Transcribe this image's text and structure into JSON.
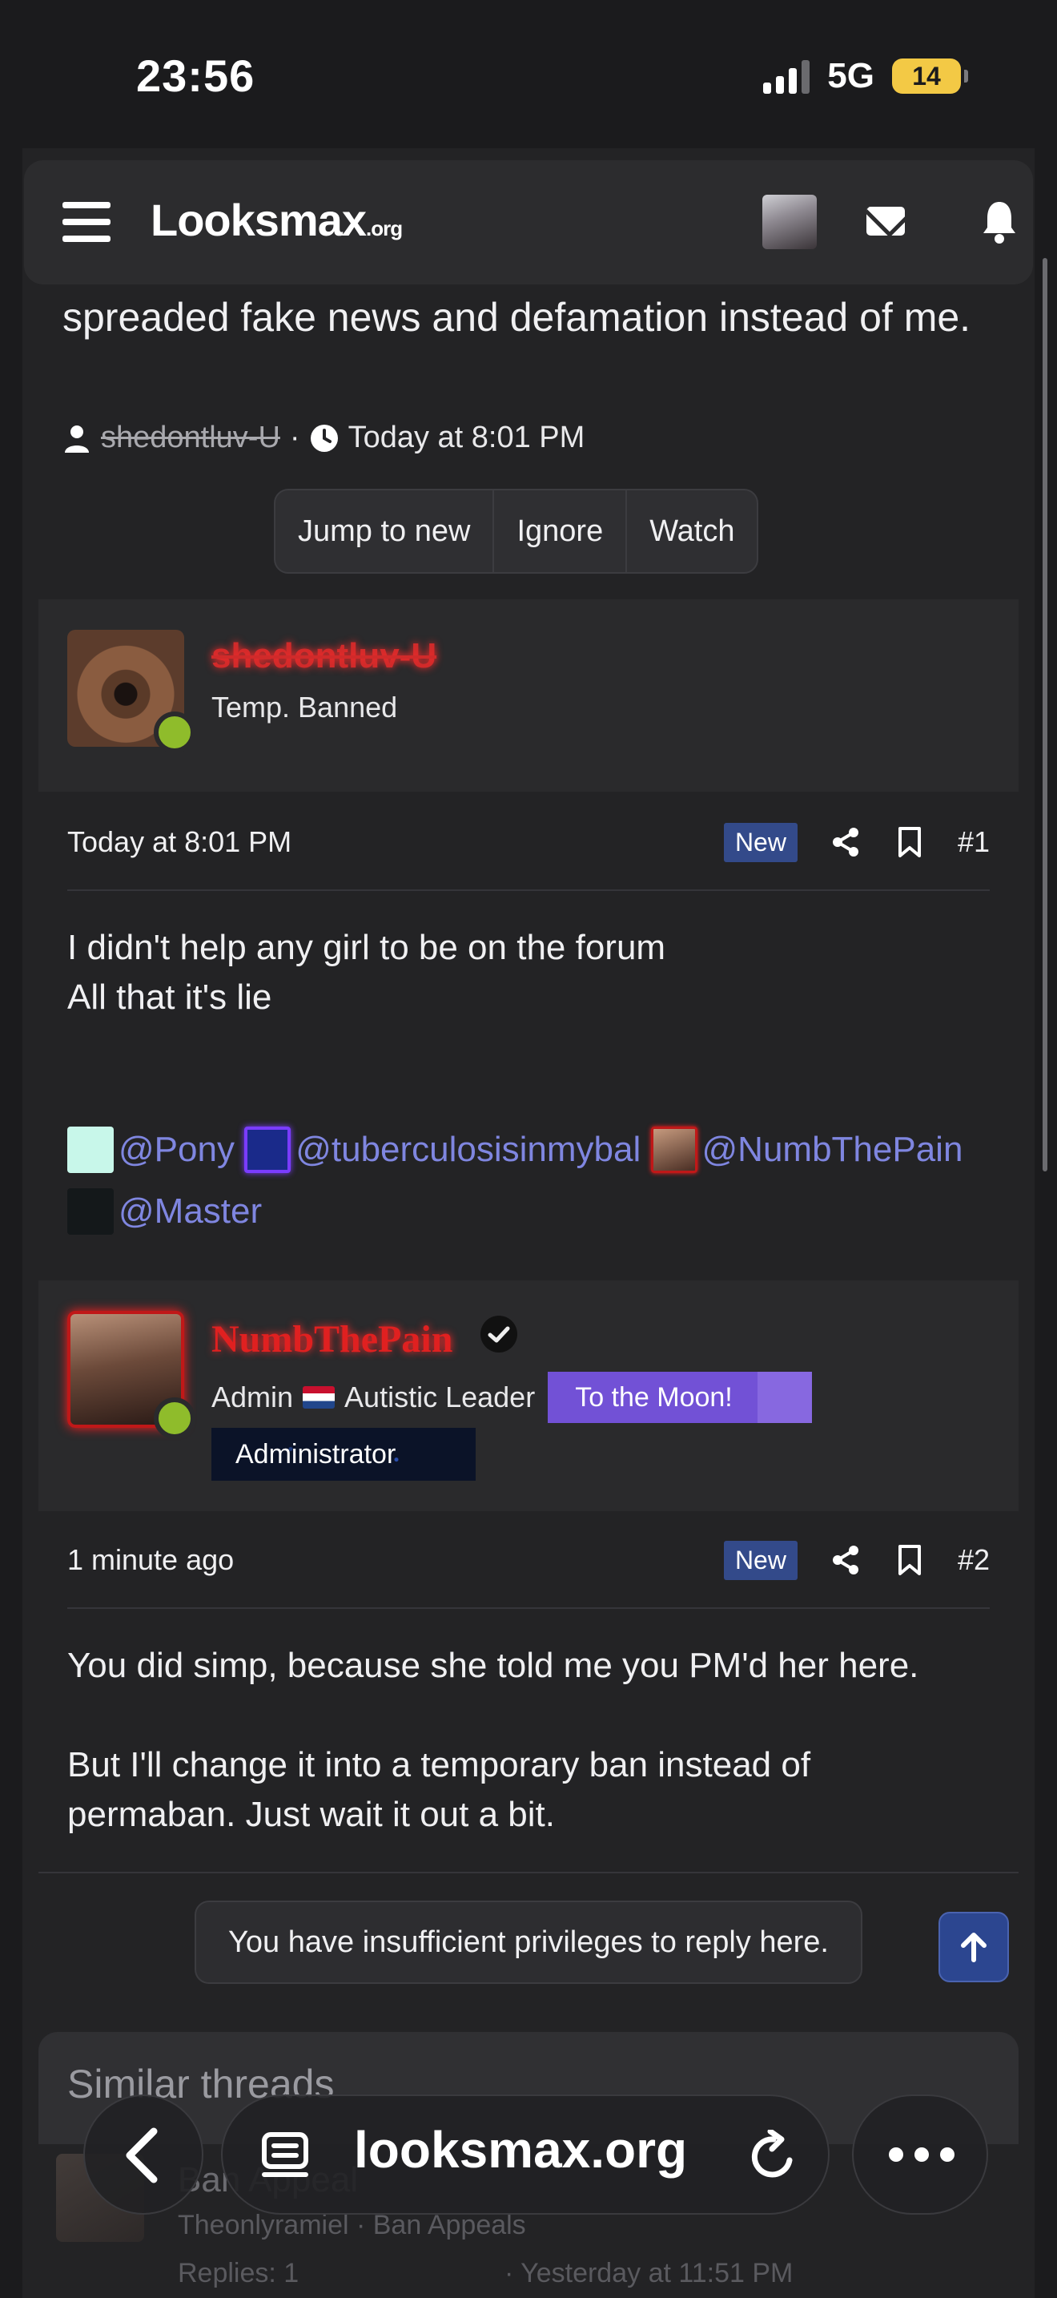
{
  "status_bar": {
    "time": "23:56",
    "network": "5G",
    "battery": "14"
  },
  "header": {
    "logo_main": "Looksmax",
    "logo_suffix": ".org"
  },
  "thread": {
    "title_text": "spreaded fake news and defamation instead of me.",
    "author": "shedontluv-U",
    "date": "Today at 8:01 PM",
    "buttons": {
      "jump": "Jump to new",
      "ignore": "Ignore",
      "watch": "Watch"
    }
  },
  "posts": [
    {
      "username": "shedontluv-U",
      "user_title": "Temp. Banned",
      "time": "Today at 8:01 PM",
      "badge": "New",
      "number": "#1",
      "body_lines": [
        "I didn't help any girl to be on the forum",
        "All that it's lie"
      ],
      "mentions": [
        "@Pony",
        "@tuberculosisinmybal",
        "@NumbThePain",
        "@Master"
      ]
    },
    {
      "username": "NumbThePain",
      "role": "Admin",
      "title": "Autistic Leader",
      "moon_badge": "To the Moon!",
      "admin_badge": "Administrator",
      "time": "1 minute ago",
      "badge": "New",
      "number": "#2",
      "body_p1": "You did simp, because she told me you PM'd her here.",
      "body_p2": "But I'll change it into a temporary ban instead of permaban. Just wait it out a bit."
    }
  ],
  "notice": "You have insufficient privileges to reply here.",
  "similar": {
    "title": "Similar threads",
    "item": {
      "title": "Ban Appeal",
      "author": "Theonlyramiel",
      "forum": "Ban Appeals",
      "replies": "Replies: 1",
      "date": "Yesterday at 11:51 PM"
    }
  },
  "browser": {
    "url": "looksmax.org"
  },
  "colors": {
    "accent": "#7f86e0",
    "banned_red": "#d02a2a",
    "admin_red": "#e02020",
    "online": "#8fbc2b",
    "new_badge": "#334a8a"
  }
}
